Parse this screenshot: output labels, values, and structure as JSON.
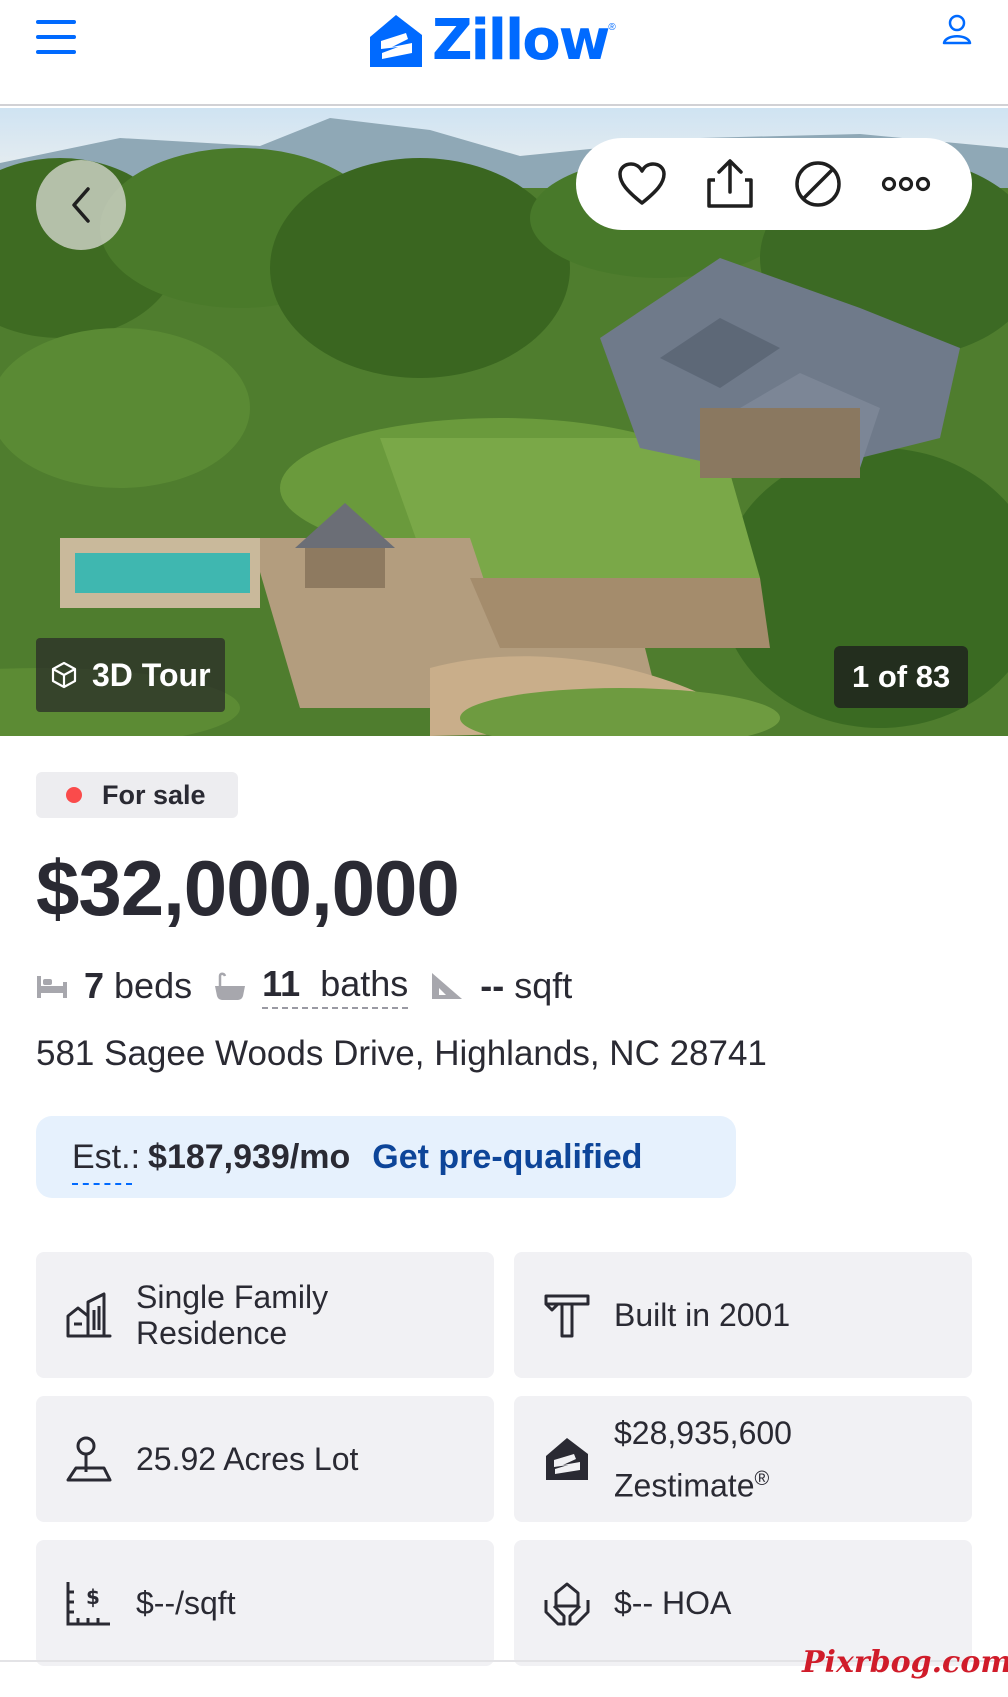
{
  "header": {
    "logo_text": "Zillow",
    "logo_reg": "®",
    "menu_icon": "hamburger-icon",
    "account_icon": "user-icon"
  },
  "hero": {
    "back_icon": "chevron-left-icon",
    "actions": [
      {
        "icon": "heart-icon"
      },
      {
        "icon": "share-icon"
      },
      {
        "icon": "hide-icon"
      },
      {
        "icon": "more-icon"
      }
    ],
    "tour_label": "3D Tour",
    "photo_count": "1 of 83"
  },
  "listing": {
    "status": "For sale",
    "status_color": "#fa4b4b",
    "price": "$32,000,000",
    "beds_value": "7",
    "beds_label": "beds",
    "baths_value": "11",
    "baths_label": "baths",
    "sqft_value": "--",
    "sqft_label": "sqft",
    "address": "581 Sagee Woods Drive, Highlands, NC 28741"
  },
  "estimate": {
    "label": "Est.:",
    "value": "$187,939/mo",
    "link": "Get pre-qualified"
  },
  "facts_cards": {
    "type": "Single Family Residence",
    "built": "Built in 2001",
    "lot": "25.92 Acres Lot",
    "zestimate_value": "$28,935,600",
    "zestimate_label": "Zestimate",
    "zestimate_reg": "®",
    "price_per_sqft": "$--/sqft",
    "hoa": "$-- HOA"
  },
  "watermark": "Pixrbog.com",
  "colors": {
    "brand": "#006aff",
    "link": "#0d4599",
    "text": "#2a2a33",
    "card_bg": "#f1f1f4",
    "estimate_bg": "#e6f1fd"
  }
}
